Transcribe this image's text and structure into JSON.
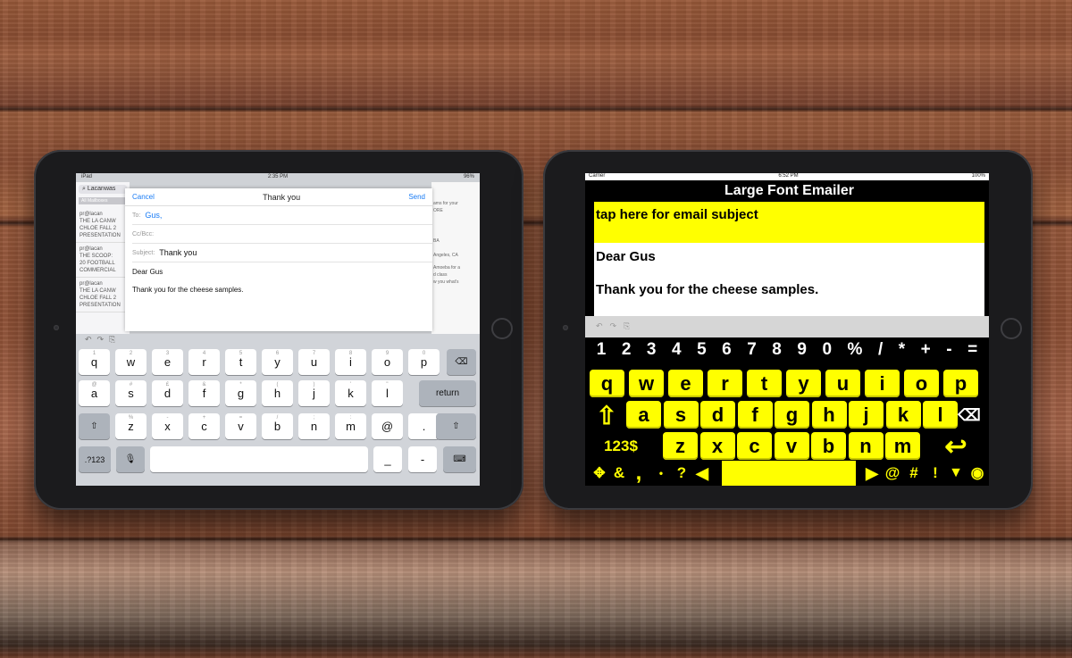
{
  "left_ipad": {
    "status": {
      "device": "iPad",
      "time": "2:35 PM",
      "battery": "96%"
    },
    "bg_list": {
      "search": "Lacanwas",
      "mailboxes": "All Mailboxes",
      "rows": [
        {
          "sender": "pr@lacan",
          "line1": "THE LA CANW",
          "line2": "CHLOE FALL 2",
          "line3": "PRESENTATION"
        },
        {
          "sender": "pr@lacan",
          "line1": "THE SCOOP:",
          "line2": "20 FOOTBALL",
          "line3": "COMMERCIAL"
        },
        {
          "sender": "pr@lacan",
          "line1": "THE LA CANW",
          "line2": "CHLOE FALL 2",
          "line3": "PRESENTATION"
        }
      ]
    },
    "bg_right_snippets": [
      "ams for your",
      "ORE",
      "BA",
      "Angeles, CA",
      "Amoeba for a",
      "d class",
      "w you what's"
    ],
    "compose": {
      "cancel": "Cancel",
      "title": "Thank you",
      "send": "Send",
      "to_label": "To:",
      "to_value": "Gus,",
      "cc_label": "Cc/Bcc:",
      "subject_label": "Subject:",
      "subject_value": "Thank you",
      "body_lines": [
        "Dear Gus",
        "Thank you for the cheese samples."
      ]
    },
    "keyboard": {
      "row1": [
        {
          "k": "q",
          "s": "1"
        },
        {
          "k": "w",
          "s": "2"
        },
        {
          "k": "e",
          "s": "3"
        },
        {
          "k": "r",
          "s": "4"
        },
        {
          "k": "t",
          "s": "5"
        },
        {
          "k": "y",
          "s": "6"
        },
        {
          "k": "u",
          "s": "7"
        },
        {
          "k": "i",
          "s": "8"
        },
        {
          "k": "o",
          "s": "9"
        },
        {
          "k": "p",
          "s": "0"
        }
      ],
      "row2": [
        {
          "k": "a",
          "s": "@"
        },
        {
          "k": "s",
          "s": "#"
        },
        {
          "k": "d",
          "s": "£"
        },
        {
          "k": "f",
          "s": "&"
        },
        {
          "k": "g",
          "s": "*"
        },
        {
          "k": "h",
          "s": "("
        },
        {
          "k": "j",
          "s": ")"
        },
        {
          "k": "k",
          "s": "'"
        },
        {
          "k": "l",
          "s": "\""
        }
      ],
      "row3": [
        {
          "k": "z",
          "s": "%"
        },
        {
          "k": "x",
          "s": "-"
        },
        {
          "k": "c",
          "s": "+"
        },
        {
          "k": "v",
          "s": "="
        },
        {
          "k": "b",
          "s": "/"
        },
        {
          "k": "n",
          "s": ";"
        },
        {
          "k": "m",
          "s": ":"
        },
        {
          "k": "@",
          "s": ""
        },
        {
          "k": ".",
          "s": ""
        }
      ],
      "return": "return",
      "numbers": ".?123",
      "underscore": "_",
      "dash": "-"
    }
  },
  "right_ipad": {
    "status": {
      "carrier": "Carrier",
      "time": "6:52 PM",
      "battery": "100%"
    },
    "app_title": "Large Font Emailer",
    "subject_placeholder": "tap here for email subject",
    "body_lines": [
      "Dear Gus",
      "Thank you for the cheese samples."
    ],
    "number_row": [
      "1",
      "2",
      "3",
      "4",
      "5",
      "6",
      "7",
      "8",
      "9",
      "0",
      "%",
      "/",
      "*",
      "+",
      "-",
      "="
    ],
    "row1": [
      "q",
      "w",
      "e",
      "r",
      "t",
      "y",
      "u",
      "i",
      "o",
      "p"
    ],
    "row2": [
      "a",
      "s",
      "d",
      "f",
      "g",
      "h",
      "j",
      "k",
      "l"
    ],
    "row3": [
      "z",
      "x",
      "c",
      "v",
      "b",
      "n",
      "m"
    ],
    "numbers_key": "123$",
    "bottom_symbols_left": [
      "&",
      ",",
      "•",
      "?"
    ],
    "bottom_symbols_right": [
      "@",
      "#",
      "!"
    ]
  },
  "colors": {
    "yellow": "#ffff00",
    "ios_blue": "#1a7cf5",
    "keyboard_gray": "#d1d4d9"
  }
}
